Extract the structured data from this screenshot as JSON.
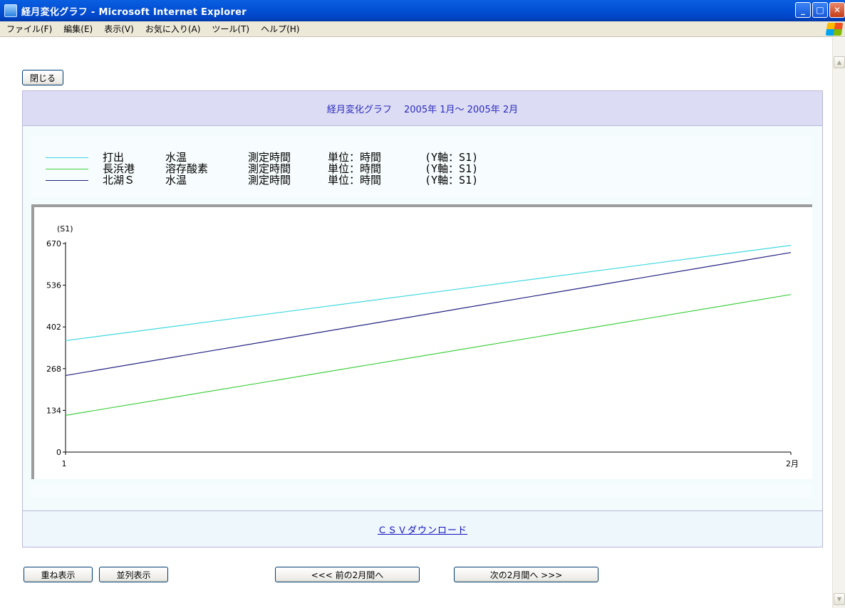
{
  "window": {
    "title": "経月変化グラフ - Microsoft Internet Explorer"
  },
  "menu": [
    "ファイル(F)",
    "編集(E)",
    "表示(V)",
    "お気に入り(A)",
    "ツール(T)",
    "ヘルプ(H)"
  ],
  "buttons": {
    "close": "閉じる",
    "overlay": "重ね表示",
    "parallel": "並列表示",
    "prev": "<<< 前の2月間へ",
    "next": "次の2月間へ >>>"
  },
  "header": {
    "title": "経月変化グラフ　 2005年 1月～ 2005年 2月"
  },
  "legend": [
    {
      "name": "打出",
      "item": "水温",
      "measure": "測定時間",
      "unit": "単位：時間",
      "axis": "(Y軸：S1)",
      "color": "#40d8e0"
    },
    {
      "name": "長浜港",
      "item": "溶存酸素",
      "measure": "測定時間",
      "unit": "単位：時間",
      "axis": "(Y軸：S1)",
      "color": "#40d040"
    },
    {
      "name": "北湖Ｓ",
      "item": "水温",
      "measure": "測定時間",
      "unit": "単位：時間",
      "axis": "(Y軸：S1)",
      "color": "#202080"
    }
  ],
  "footer": {
    "csv_link": "ＣＳＶダウンロード"
  },
  "chart_data": {
    "type": "line",
    "ylabel": "(S1)",
    "ylim": [
      0,
      670
    ],
    "yticks": [
      "0",
      "134",
      "268",
      "402",
      "536",
      "670"
    ],
    "x": [
      "1",
      "2月"
    ],
    "series": [
      {
        "name": "打出",
        "values": [
          358,
          664
        ],
        "color": "#40d8e0"
      },
      {
        "name": "長浜港",
        "values": [
          118,
          506
        ],
        "color": "#40d040"
      },
      {
        "name": "北湖Ｓ",
        "values": [
          246,
          641
        ],
        "color": "#202080"
      }
    ]
  }
}
